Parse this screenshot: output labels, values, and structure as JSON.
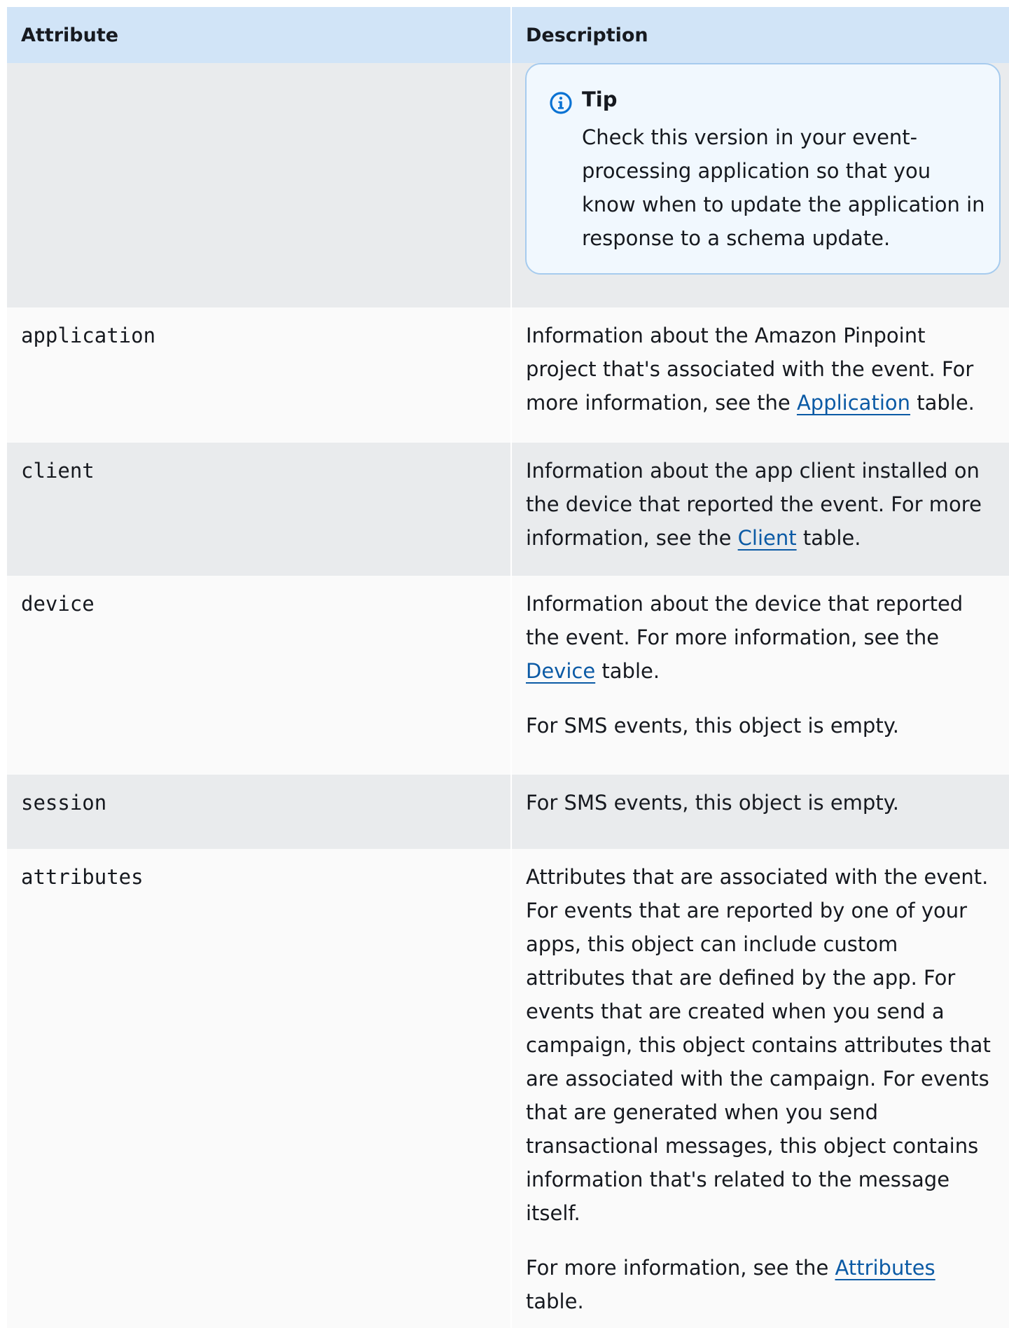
{
  "table": {
    "headers": {
      "attribute": "Attribute",
      "description": "Description"
    },
    "tip": {
      "title": "Tip",
      "text": "Check this version in your event-processing application so that you know when to update the application in response to a schema update."
    },
    "rows": [
      {
        "attribute": "application",
        "desc_before": "Information about the Amazon Pinpoint project that's associated with the event. For more information, see the ",
        "link": "Application",
        "desc_after": " table."
      },
      {
        "attribute": "client",
        "desc_before": "Information about the app client installed on the device that reported the event. For more information, see the ",
        "link": "Client",
        "desc_after": " table."
      },
      {
        "attribute": "device",
        "desc_before": "Information about the device that reported the event. For more information, see the ",
        "link": "Device",
        "desc_after": " table.",
        "note": "For SMS events, this object is empty."
      },
      {
        "attribute": "session",
        "desc": "For SMS events, this object is empty."
      },
      {
        "attribute": "attributes",
        "desc": "Attributes that are associated with the event. For events that are reported by one of your apps, this object can include custom attributes that are defined by the app. For events that are created when you send a campaign, this object contains attributes that are associated with the campaign. For events that are generated when you send transactional messages, this object contains information that's related to the message itself.",
        "more_before": "For more information, see the ",
        "link": "Attributes",
        "more_after": " table."
      }
    ]
  },
  "colors": {
    "header_bg": "#d1e4f7",
    "row_odd_bg": "#e9ebed",
    "row_even_bg": "#fafafa",
    "tip_bg": "#f1f8fe",
    "tip_border": "#a6cbee",
    "link": "#0b5aa5",
    "info_icon": "#0972d3"
  },
  "icons": {
    "tip": "info-circle-icon"
  }
}
